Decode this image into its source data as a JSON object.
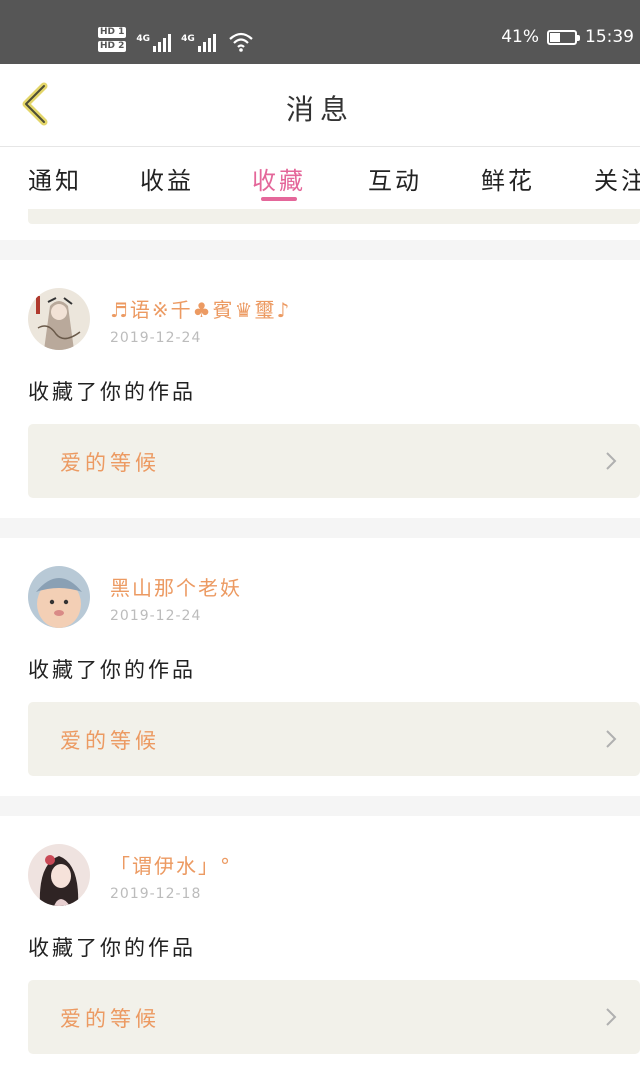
{
  "status_bar": {
    "hd1": "HD 1",
    "hd2": "HD 2",
    "net1": "4G",
    "net2": "4G",
    "battery_percent": "41%",
    "battery_level": 0.41,
    "time": "15:39"
  },
  "header": {
    "title": "消息"
  },
  "tabs": [
    {
      "label": "通知"
    },
    {
      "label": "收益"
    },
    {
      "label": "收藏"
    },
    {
      "label": "互动"
    },
    {
      "label": "鲜花"
    },
    {
      "label": "关注"
    }
  ],
  "active_tab": "收藏",
  "colors": {
    "accent": "#e4679a",
    "username": "#ec9a62",
    "card_bg": "#f2f1ea",
    "back_icon": "#e4d66a"
  },
  "items": [
    {
      "user": "♬语※千♣賓♛璽♪",
      "date": "2019-12-24",
      "action": "收藏了你的作品",
      "work": "爱的等候"
    },
    {
      "user": "黑山那个老妖",
      "date": "2019-12-24",
      "action": "收藏了你的作品",
      "work": "爱的等候"
    },
    {
      "user": "「谓伊水」°",
      "date": "2019-12-18",
      "action": "收藏了你的作品",
      "work": "爱的等候"
    }
  ]
}
